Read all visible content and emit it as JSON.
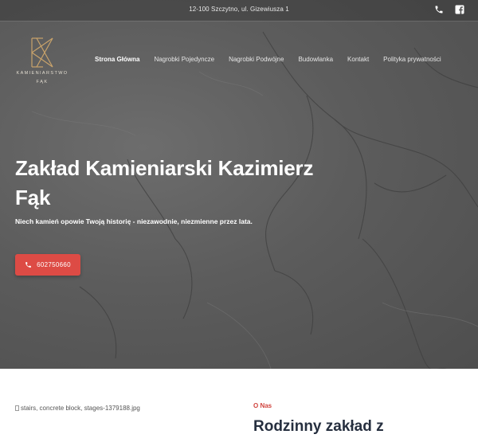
{
  "topbar": {
    "address": "12-100 Szczytno, ul. Gizewiusza 1",
    "icons": [
      "phone-icon",
      "facebook-icon"
    ]
  },
  "logo": {
    "line1": "KAMIENIARSTWO",
    "line2": "FĄK",
    "color": "#c9a36b"
  },
  "nav": {
    "items": [
      {
        "label": "Strona Główna",
        "active": true
      },
      {
        "label": "Nagrobki Pojedyncze"
      },
      {
        "label": "Nagrobki Podwójne"
      },
      {
        "label": "Budowlanka"
      },
      {
        "label": "Kontakt"
      },
      {
        "label": "Polityka prywatności"
      }
    ]
  },
  "hero": {
    "title": "Zakład Kamieniarski Kazimierz Fąk",
    "subtitle": "Niech kamień opowie Twoją historię - niezawodnie, niezmienne przez lata.",
    "cta": {
      "phone": "602750660",
      "icon": "phone-icon",
      "color": "#dd4b45"
    }
  },
  "about": {
    "image_alt": "stairs, concrete block, stages-1379188.jpg",
    "label": "O Nas",
    "title": "Rodzinny zakład z",
    "accent": "#d0433d"
  }
}
